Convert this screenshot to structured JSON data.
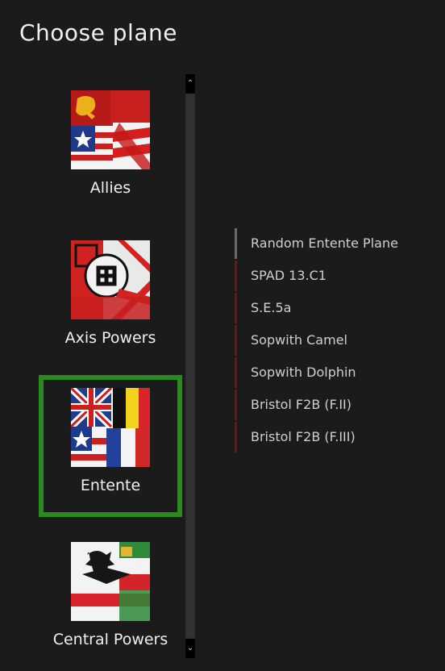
{
  "header": {
    "title": "Choose plane"
  },
  "factions": [
    {
      "label": "Allies",
      "selected": false,
      "flag_icon": "allies-flag-icon"
    },
    {
      "label": "Axis Powers",
      "selected": false,
      "flag_icon": "axis-flag-icon"
    },
    {
      "label": "Entente",
      "selected": true,
      "flag_icon": "entente-flag-icon"
    },
    {
      "label": "Central Powers",
      "selected": false,
      "flag_icon": "central-powers-flag-icon"
    }
  ],
  "scrollbar": {
    "up_icon": "chevron-up-icon",
    "down_icon": "chevron-down-icon",
    "up_glyph": "⌃",
    "down_glyph": "⌄"
  },
  "planes": [
    {
      "label": "Random Entente Plane"
    },
    {
      "label": "SPAD 13.C1"
    },
    {
      "label": "S.E.5a"
    },
    {
      "label": "Sopwith Camel"
    },
    {
      "label": "Sopwith Dolphin"
    },
    {
      "label": "Bristol F2B (F.II)"
    },
    {
      "label": "Bristol F2B (F.III)"
    }
  ],
  "colors": {
    "selection": "#2a8a1e",
    "plane_marker": "#6e1515",
    "random_marker": "#6a6a6a",
    "background": "#1b1b1b"
  }
}
